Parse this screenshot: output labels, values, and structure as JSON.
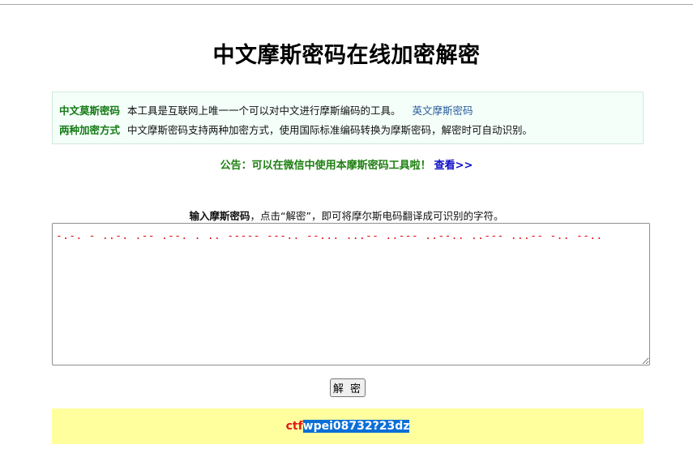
{
  "page": {
    "title": "中文摩斯密码在线加密解密"
  },
  "info": {
    "row1": {
      "label": "中文莫斯密码",
      "text": "本工具是互联网上唯一一个可以对中文进行摩斯编码的工具。",
      "link": "英文摩斯密码"
    },
    "row2": {
      "label": "两种加密方式",
      "text": "中文摩斯密码支持两种加密方式，使用国际标准编码转换为摩斯密码，解密时可自动识别。"
    }
  },
  "notice": {
    "text": "公告：可以在微信中使用本摩斯密码工具啦！",
    "link": "查看>>"
  },
  "instruction": {
    "bold": "输入摩斯密码",
    "rest": "，点击“解密”，即可将摩尔斯电码翻译成可识别的字符。"
  },
  "morse_input": {
    "value": "-.-. - ..-. .-- .--. . .. ----- ---.. --... ...-- ..--- ..--.. ..--- ...-- -.. --.."
  },
  "decode_button": {
    "label": "解 密"
  },
  "result": {
    "prefix": "ctf",
    "highlighted": "wpei08732?23dz"
  }
}
